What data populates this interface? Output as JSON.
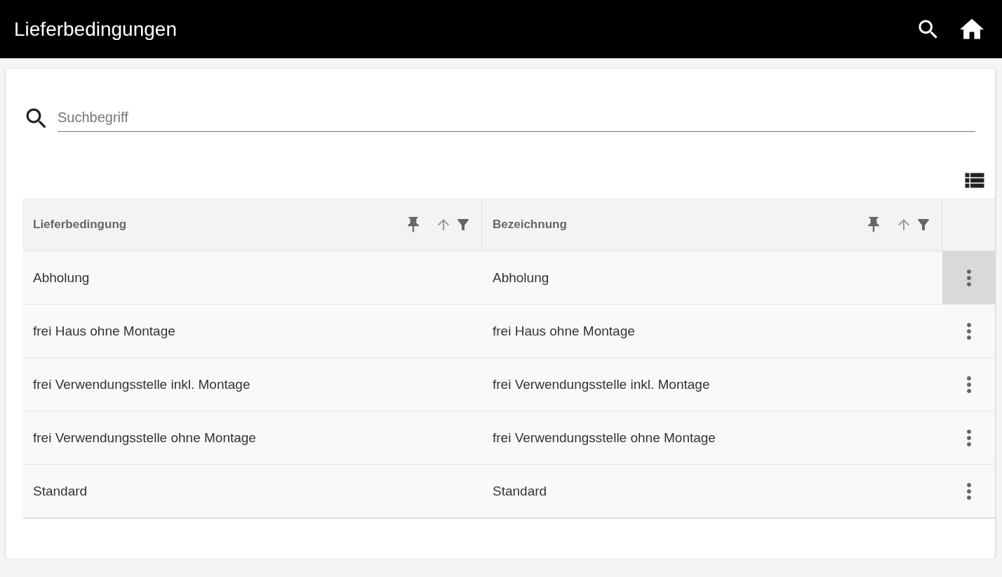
{
  "app_bar": {
    "title": "Lieferbedingungen"
  },
  "search": {
    "placeholder": "Suchbegriff"
  },
  "table": {
    "columns": [
      {
        "label": "Lieferbedingung"
      },
      {
        "label": "Bezeichnung"
      }
    ],
    "rows": [
      {
        "cells": [
          "Abholung",
          "Abholung"
        ],
        "menu_highlighted": true
      },
      {
        "cells": [
          "frei Haus ohne Montage",
          "frei Haus ohne Montage"
        ],
        "menu_highlighted": false
      },
      {
        "cells": [
          "frei Verwendungsstelle inkl. Montage",
          "frei Verwendungsstelle inkl. Montage"
        ],
        "menu_highlighted": false
      },
      {
        "cells": [
          "frei Verwendungsstelle ohne Montage",
          "frei Verwendungsstelle ohne Montage"
        ],
        "menu_highlighted": false
      },
      {
        "cells": [
          "Standard",
          "Standard"
        ],
        "menu_highlighted": false
      }
    ]
  }
}
